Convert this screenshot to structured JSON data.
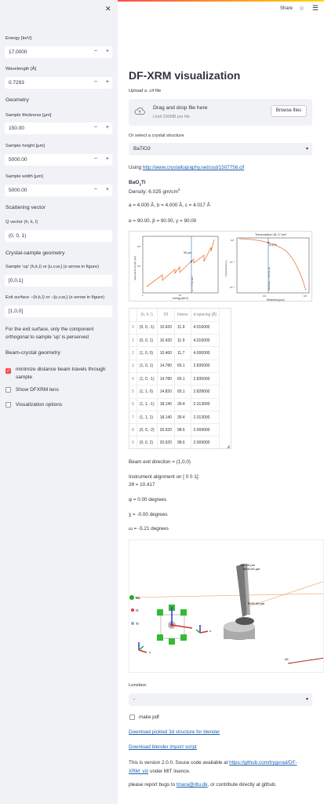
{
  "header": {
    "share": "Share",
    "star_icon": "star-icon",
    "menu_icon": "menu-icon"
  },
  "sidebar": {
    "close_icon": "close-icon",
    "energy": {
      "label": "Energy [keV]",
      "value": "17.0000"
    },
    "wavelength": {
      "label": "Wavelength [Å]",
      "value": "0.7293"
    },
    "geometry_title": "Geometry",
    "thickness": {
      "label": "Sample thickness [µm]",
      "value": "150.00"
    },
    "height": {
      "label": "Sample height [µm]",
      "value": "5000.00"
    },
    "width": {
      "label": "Sample width [µm]",
      "value": "5000.00"
    },
    "minus": "−",
    "plus": "+",
    "scattering_title": "Scattering vector",
    "qvec": {
      "label": "Q vector (h, k, l)",
      "value": "(0, 0, 1)"
    },
    "crystal_sample_title": "Crystal-sample geometry",
    "up": {
      "label": "Sample 'up' (h,k,l) or [u,v,w,] (z-arrow in figure)",
      "value": "[0,0,1]"
    },
    "exit": {
      "label": "Exit surface −(h,k,l) or −[u,v,w,] (x-arrow in figure)",
      "value": "[1,0,0]"
    },
    "note": "For the exit surface, only the component orthogonal to sample 'up' is perserved",
    "beam_title": "Beam-crystal geometry",
    "check_minimize": "minimize distance beam travels through sample",
    "check_lens": "Show DFXRM lens",
    "check_vis": "Visualization options"
  },
  "main": {
    "title": "DF-XRM visualization",
    "upload_label": "Upload a .cif file",
    "drop_text": "Drag and drop file here",
    "limit_text": "Limit 200MB per file",
    "browse_label": "Browse files",
    "or_select": "Or select a crystal structure",
    "structure": "BaTiO3",
    "using_prefix": "Using",
    "using_link": "http://www.crystallography.net/cod/1507756.cif",
    "formula": "BaO3Ti",
    "density": "Density: 6.025 gm/cm",
    "density_sup": "3",
    "cell_abc": "a = 4.000 Å, b = 4.000 Å, c = 4.017 Å",
    "cell_angles": "α = 90.00, β = 90.00, γ = 90.00",
    "fig_left": {
      "xlabel": "energy [keV]",
      "ylabel": "Attenuation length [µm]",
      "vline_label": "E = 17.00 keV",
      "point_label": "55 µm"
    },
    "fig_right": {
      "title": "Transmission @ 17 keV",
      "xlabel": "thickness [µm]",
      "ylabel": "Transmission [-]",
      "vline_label": "thickness = 150.00 µm",
      "point_label": "6.47%"
    },
    "table": {
      "headers": [
        "",
        "(h, k, l)",
        "2θ",
        "Intens",
        "d-spacing [Å]"
      ],
      "rows": [
        [
          "0",
          "(0, 0, -1)",
          "10.420",
          "11.9",
          "4.016000"
        ],
        [
          "1",
          "(0, 0, 1)",
          "10.420",
          "11.9",
          "4.016000"
        ],
        [
          "2",
          "(1, 0, 0)",
          "10.460",
          "11.7",
          "4.000000"
        ],
        [
          "3",
          "(1, 0, 1)",
          "14.780",
          "65.1",
          "2.835000"
        ],
        [
          "4",
          "(1, 0, -1)",
          "14.780",
          "65.1",
          "2.835000"
        ],
        [
          "5",
          "(1, 1, 0)",
          "14.820",
          "65.1",
          "2.828000"
        ],
        [
          "6",
          "(1, 1, -1)",
          "18.140",
          "39.4",
          "2.313000"
        ],
        [
          "7",
          "(1, 1, 1)",
          "18.140",
          "39.4",
          "2.313000"
        ],
        [
          "8",
          "(0, 0, -2)",
          "20.920",
          "98.6",
          "2.009000"
        ],
        [
          "9",
          "(0, 0, 2)",
          "20.920",
          "98.6",
          "2.009000"
        ]
      ]
    },
    "beam_exit": "Beam exit direction = (1,0,0)",
    "alignment": "Instrument alignment on [ 0 0 1]:",
    "two_theta": "2θ = 10.417",
    "phi": "φ = 0.00 degrees",
    "chi": "χ = -0.00 degrees",
    "omega": "ω = -5.21 degrees",
    "scene": {
      "legend": [
        "Ba",
        "O",
        "Ti"
      ],
      "dim1": "150.00 µm",
      "dim2": "5000.00 µm",
      "dim3": "5000.00 µm",
      "scale": "40"
    },
    "lensbox_label": "Lensbox:",
    "lensbox_value": "-",
    "make_pdf": "make pdf",
    "dl_pickle": "Download pickled 3d structure for blender",
    "dl_blender": "Download blender import script",
    "version_prefix": "This is version 2.0.0. Souce code available at",
    "version_link": "https://github.com/trygvrad/DF-XRM_viz",
    "version_suffix": "under MIT lisence.",
    "bugs_prefix": "please report bugs to",
    "bugs_link": "tmara@dtu.dk",
    "bugs_suffix": ", or contribute directly at github."
  }
}
